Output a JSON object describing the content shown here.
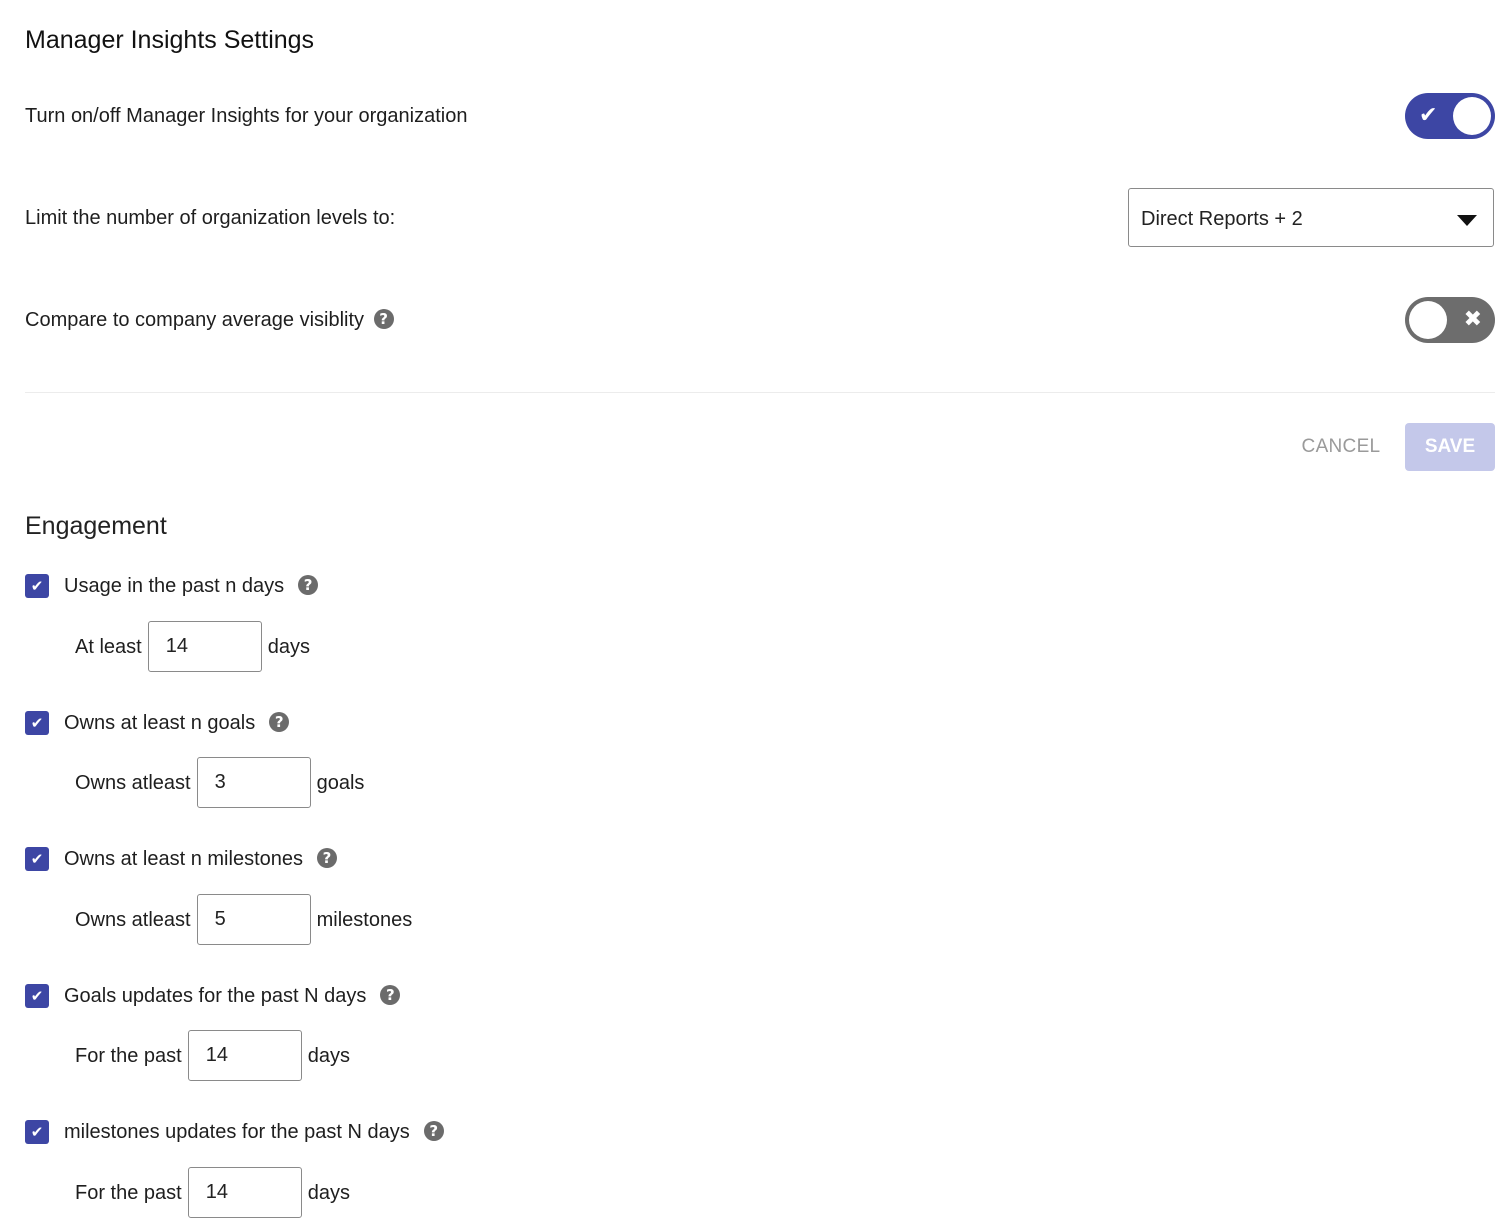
{
  "page_title": "Manager Insights Settings",
  "settings": {
    "enable_label": "Turn on/off Manager Insights for your organization",
    "enable_toggle": {
      "state": "on",
      "glyph": "✔"
    },
    "levels_label": "Limit the number of organization levels to:",
    "levels_select": {
      "value": "Direct Reports + 2"
    },
    "compare_label": "Compare to company average visiblity",
    "compare_toggle": {
      "state": "off",
      "glyph": "✖"
    }
  },
  "actions": {
    "cancel_label": "CANCEL",
    "save_label": "SAVE"
  },
  "engagement": {
    "title": "Engagement",
    "criteria": [
      {
        "label": "Usage in the past n days",
        "checked": true,
        "lead": "At least",
        "value": "14",
        "unit": "days"
      },
      {
        "label": "Owns at least n goals",
        "checked": true,
        "lead": "Owns atleast",
        "value": "3",
        "unit": "goals"
      },
      {
        "label": "Owns at least n milestones",
        "checked": true,
        "lead": "Owns atleast",
        "value": "5",
        "unit": "milestones"
      },
      {
        "label": "Goals updates for the past N days",
        "checked": true,
        "lead": "For the past",
        "value": "14",
        "unit": "days"
      },
      {
        "label": "milestones updates for the past N days",
        "checked": true,
        "lead": "For the past",
        "value": "14",
        "unit": "days"
      }
    ]
  },
  "icons": {
    "help": "question-circle-icon",
    "checkbox_check": "check-icon",
    "help_glyph": "?",
    "check_glyph": "✔"
  },
  "colors": {
    "primary": "#3d46a4",
    "toggle_off": "#6d6d6d",
    "save_disabled": "#c4c8ea",
    "cancel_text": "#9a9a9a",
    "help_icon": "#6b6b6b"
  }
}
